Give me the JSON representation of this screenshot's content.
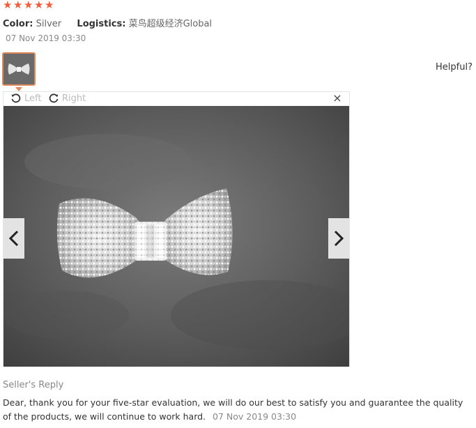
{
  "review": {
    "stars": [
      "★",
      "★",
      "★",
      "★",
      "★"
    ],
    "rating": 5,
    "color_label": "Color:",
    "color_value": "Silver",
    "logistics_label": "Logistics:",
    "logistics_value": "菜鸟超级经济Global",
    "date": "07 Nov 2019 03:30",
    "helpful_label": "Helpful?"
  },
  "viewer": {
    "rotate_left_label": "Left",
    "rotate_right_label": "Right",
    "close_label": "×"
  },
  "seller_reply": {
    "title": "Seller's Reply",
    "text": "Dear, thank you for your five-star evaluation, we will do our best to satisfy you and guarantee the quality of the products, we will continue to work hard.",
    "date": "07 Nov 2019 03:30"
  },
  "colors": {
    "star": "#f25c3b",
    "thumb_border": "#e08a5c"
  }
}
